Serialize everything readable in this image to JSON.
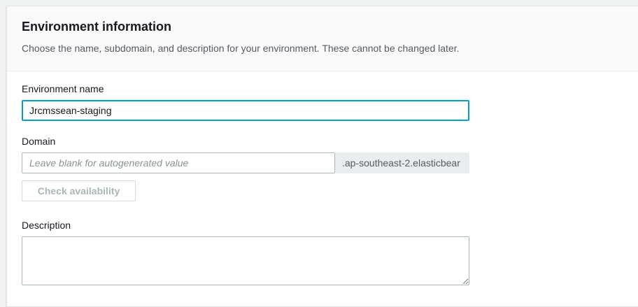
{
  "section": {
    "title": "Environment information",
    "subtitle": "Choose the name, subdomain, and description for your environment. These cannot be changed later."
  },
  "environment_name": {
    "label": "Environment name",
    "value": "Jrcmssean-staging"
  },
  "domain": {
    "label": "Domain",
    "placeholder": "Leave blank for autogenerated value",
    "suffix": ".ap-southeast-2.elasticbear",
    "check_button": "Check availability"
  },
  "description": {
    "label": "Description",
    "value": ""
  }
}
